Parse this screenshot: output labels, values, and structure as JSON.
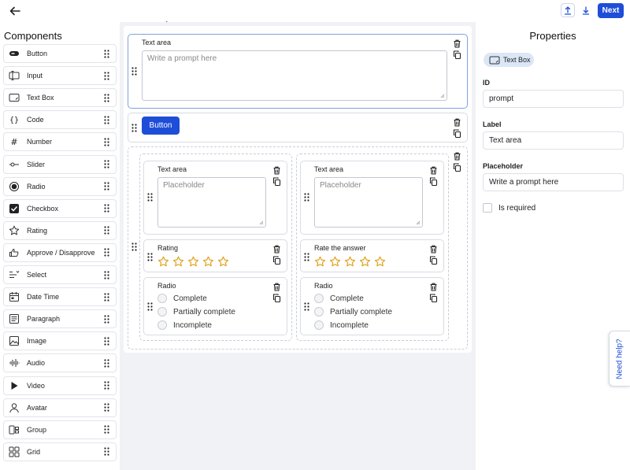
{
  "header": {
    "back_icon": "arrow-left-icon",
    "upload_icon": "upload-icon",
    "download_icon": "download-icon",
    "next_label": "Next",
    "accent": "#1e4ed8"
  },
  "sidebar": {
    "title": "Components",
    "items": [
      {
        "label": "Button",
        "icon": "button-icon"
      },
      {
        "label": "Input",
        "icon": "input-icon"
      },
      {
        "label": "Text Box",
        "icon": "textbox-icon"
      },
      {
        "label": "Code",
        "icon": "code-braces-icon"
      },
      {
        "label": "Number",
        "icon": "hash-icon"
      },
      {
        "label": "Slider",
        "icon": "slider-icon"
      },
      {
        "label": "Radio",
        "icon": "radio-icon"
      },
      {
        "label": "Checkbox",
        "icon": "checkbox-icon"
      },
      {
        "label": "Rating",
        "icon": "star-icon"
      },
      {
        "label": "Approve / Disapprove",
        "icon": "thumbs-icon"
      },
      {
        "label": "Select",
        "icon": "select-list-icon"
      },
      {
        "label": "Date Time",
        "icon": "calendar-icon"
      },
      {
        "label": "Paragraph",
        "icon": "paragraph-icon"
      },
      {
        "label": "Image",
        "icon": "image-icon"
      },
      {
        "label": "Audio",
        "icon": "audio-wave-icon"
      },
      {
        "label": "Video",
        "icon": "play-icon"
      },
      {
        "label": "Avatar",
        "icon": "avatar-icon"
      },
      {
        "label": "Group",
        "icon": "group-icon"
      },
      {
        "label": "Grid",
        "icon": "grid-icon"
      }
    ]
  },
  "canvas": {
    "textarea_card": {
      "label": "Text area",
      "placeholder": "Write a prompt here"
    },
    "button_card": {
      "label": "Button"
    },
    "left_column": {
      "textarea": {
        "label": "Text area",
        "placeholder": "Placeholder"
      },
      "rating": {
        "label": "Rating",
        "value": 0,
        "max": 5
      },
      "radio": {
        "label": "Radio",
        "options": [
          "Complete",
          "Partially complete",
          "Incomplete"
        ]
      }
    },
    "right_column": {
      "textarea": {
        "label": "Text area",
        "placeholder": "Placeholder"
      },
      "rating": {
        "label": "Rate the answer",
        "value": 0,
        "max": 5
      },
      "radio": {
        "label": "Radio",
        "options": [
          "Complete",
          "Partially complete",
          "Incomplete"
        ]
      }
    }
  },
  "properties": {
    "title": "Properties",
    "type_chip": "Text Box",
    "id_label": "ID",
    "id_value": "prompt",
    "label_label": "Label",
    "label_value": "Text area",
    "placeholder_label": "Placeholder",
    "placeholder_value": "Write a prompt here",
    "required_label": "Is required",
    "required_checked": false
  },
  "help": {
    "label": "Need help?"
  }
}
